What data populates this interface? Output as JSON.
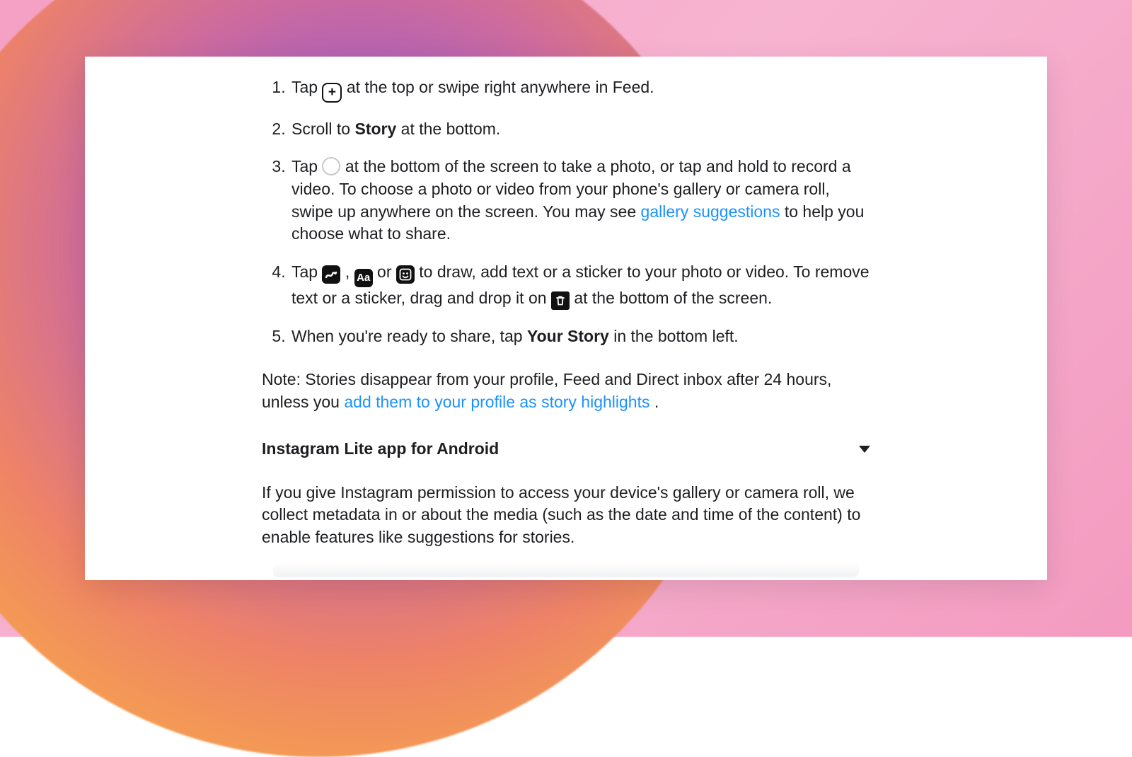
{
  "steps": {
    "s1a": "Tap ",
    "s1b": " at the top or swipe right anywhere in Feed.",
    "s2a": "Scroll to ",
    "s2b": "Story",
    "s2c": " at the bottom.",
    "s3a": "Tap ",
    "s3b": " at the bottom of the screen to take a photo, or tap and hold to record a video. To choose a photo or video from your phone's gallery or camera roll, swipe up anywhere on the screen. You may see ",
    "s3link": "gallery suggestions",
    "s3c": " to help you choose what to share.",
    "s4a": "Tap ",
    "s4b": ", ",
    "s4c": " or ",
    "s4d": " to draw, add text or a sticker to your photo or video. To remove text or a sticker, drag and drop it on ",
    "s4e": " at the bottom of the screen.",
    "s5a": "When you're ready to share, tap ",
    "s5b": "Your Story",
    "s5c": " in the bottom left."
  },
  "note": {
    "a": "Note: Stories disappear from your profile, Feed and Direct inbox after 24 hours, unless you ",
    "link": "add them to your profile as story highlights",
    "b": "."
  },
  "accordion": {
    "title": "Instagram Lite app for Android"
  },
  "permission": "If you give Instagram permission to access your device's gallery or camera roll, we collect metadata in or about the media (such as the date and time of the content) to enable features like suggestions for stories.",
  "icons": {
    "aa": "Aa"
  }
}
